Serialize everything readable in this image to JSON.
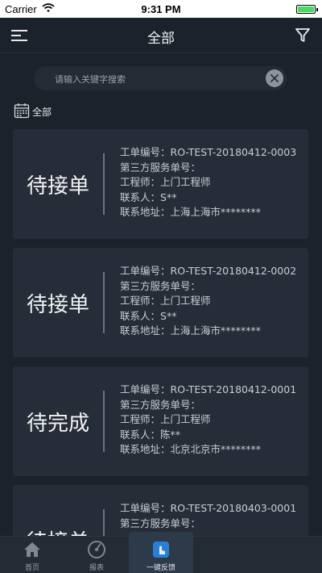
{
  "status_bar": {
    "carrier": "Carrier",
    "time": "9:31 PM"
  },
  "navbar": {
    "title": "全部"
  },
  "search": {
    "placeholder": "请输入关键字搜索"
  },
  "filter": {
    "label": "全部"
  },
  "labels": {
    "order_no": "工单编号：",
    "third_party": "第三方服务单号：",
    "engineer": "工程师：",
    "contact": "联系人：",
    "address": "联系地址："
  },
  "orders": [
    {
      "status": "待接单",
      "order_no": "RO-TEST-20180412-0003",
      "third_party": "",
      "engineer": "上门工程师",
      "contact": "S**",
      "address": "上海上海市********"
    },
    {
      "status": "待接单",
      "order_no": "RO-TEST-20180412-0002",
      "third_party": "",
      "engineer": "上门工程师",
      "contact": "S**",
      "address": "上海上海市********"
    },
    {
      "status": "待完成",
      "order_no": "RO-TEST-20180412-0001",
      "third_party": "",
      "engineer": "上门工程师",
      "contact": "陈**",
      "address": "北京北京市********"
    },
    {
      "status": "待接单",
      "order_no": "RO-TEST-20180403-0001",
      "third_party": "",
      "engineer": "",
      "contact": "",
      "address": ""
    }
  ],
  "tabbar": {
    "items": [
      {
        "label": "首页",
        "icon": "home-icon"
      },
      {
        "label": "报表",
        "icon": "gauge-icon"
      },
      {
        "label": "一键反馈",
        "icon": "touch-icon"
      }
    ]
  },
  "colors": {
    "background": "#1c222b",
    "card": "#262d38",
    "tabbar": "#242b35"
  }
}
